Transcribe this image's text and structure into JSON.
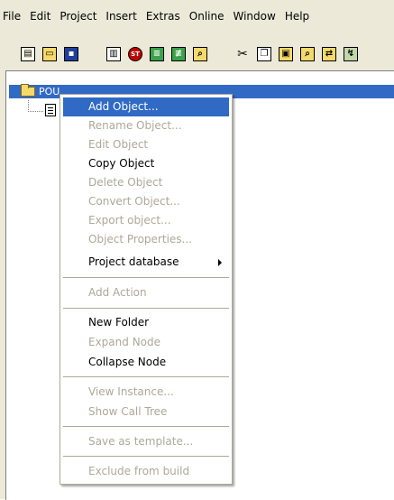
{
  "menubar": [
    "File",
    "Edit",
    "Project",
    "Insert",
    "Extras",
    "Online",
    "Window",
    "Help"
  ],
  "toolbar": {
    "icons": [
      "new-file-icon",
      "open-folder-icon",
      "save-icon",
      "print-icon",
      "stop-icon",
      "login-icon",
      "logout-icon",
      "search-icon",
      "cut-icon",
      "copy-icon",
      "paste-icon",
      "find-icon",
      "replace-icon",
      "other-icon"
    ],
    "stop_label": "ST"
  },
  "tree": {
    "root_label": "POU"
  },
  "context_menu": {
    "items": [
      {
        "label": "Add Object...",
        "enabled": true,
        "highlighted": true
      },
      {
        "label": "Rename Object...",
        "enabled": false
      },
      {
        "label": "Edit Object",
        "enabled": false
      },
      {
        "label": "Copy Object",
        "enabled": true
      },
      {
        "label": "Delete Object",
        "enabled": false
      },
      {
        "label": "Convert Object...",
        "enabled": false
      },
      {
        "label": "Export object...",
        "enabled": false
      },
      {
        "label": "Object Properties...",
        "enabled": false
      },
      {
        "label": "Project database",
        "enabled": true,
        "submenu": true
      },
      {
        "label": "Add Action",
        "enabled": false
      },
      {
        "label": "New Folder",
        "enabled": true
      },
      {
        "label": "Expand Node",
        "enabled": false
      },
      {
        "label": "Collapse Node",
        "enabled": true
      },
      {
        "label": "View Instance...",
        "enabled": false
      },
      {
        "label": "Show Call Tree",
        "enabled": false
      },
      {
        "label": "Save as template...",
        "enabled": false
      },
      {
        "label": "Exclude from build",
        "enabled": false
      }
    ]
  },
  "colors": {
    "highlight": "#316ac5",
    "disabled_text": "#aca899",
    "chrome": "#ece9d8"
  }
}
